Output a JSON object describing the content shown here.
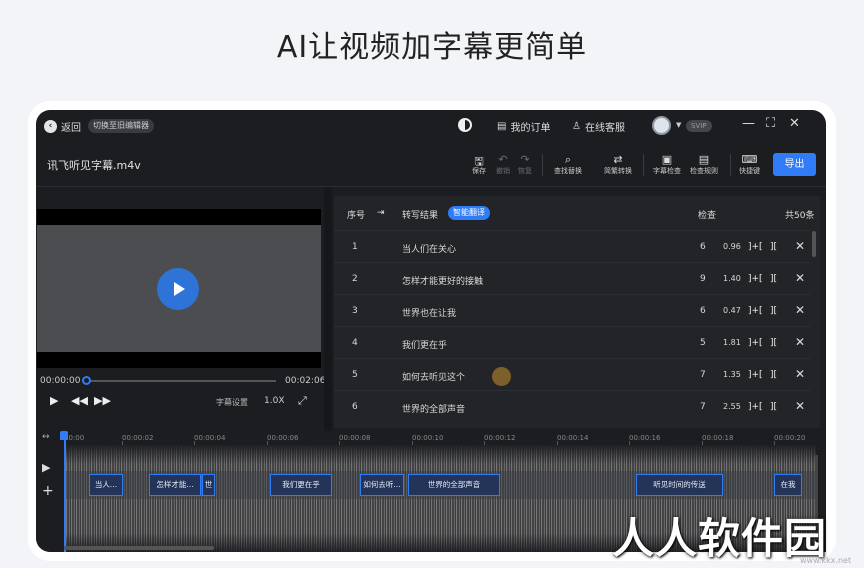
{
  "headline": "AI让视频加字幕更简单",
  "titlebar": {
    "back_label": "返回",
    "switch_label": "切换至旧编辑器",
    "orders_label": "我的订单",
    "service_label": "在线客服",
    "svip_label": "SVIP"
  },
  "file": {
    "name": "讯飞听见字幕.m4v"
  },
  "toolbar": {
    "save": "保存",
    "undo": "撤销",
    "redo": "恢复",
    "find_replace": "查找替换",
    "trad_simp": "简繁转换",
    "subtitle_check": "字幕检查",
    "check_rules": "检查规则",
    "shortcuts": "快捷键",
    "export": "导出"
  },
  "player": {
    "current_time": "00:00:00",
    "total_time": "00:02:06",
    "subtitle_setting": "字幕设置",
    "speed": "1.0X",
    "progress": 0
  },
  "list": {
    "col_no": "序号",
    "col_result": "转写结果",
    "smart_btn": "智能翻译",
    "col_check": "检查",
    "total": "共50条",
    "rows": [
      {
        "no": "1",
        "text": "当人们在关心",
        "chk": "6",
        "dur": "0.96"
      },
      {
        "no": "2",
        "text": "怎样才能更好的接触",
        "chk": "9",
        "dur": "1.40"
      },
      {
        "no": "3",
        "text": "世界也在让我",
        "chk": "6",
        "dur": "0.47"
      },
      {
        "no": "4",
        "text": "我们更在乎",
        "chk": "5",
        "dur": "1.81"
      },
      {
        "no": "5",
        "text": "如何去听见这个",
        "chk": "7",
        "dur": "1.35"
      },
      {
        "no": "6",
        "text": "世界的全部声音",
        "chk": "7",
        "dur": "2.55"
      }
    ],
    "merge_prev": "]+[",
    "split": "][",
    "delete": "✕"
  },
  "timeline": {
    "ticks": [
      "00:00",
      "00:00:02",
      "00:00:04",
      "00:00:06",
      "00:00:08",
      "00:00:10",
      "00:00:12",
      "00:00:14",
      "00:00:16",
      "00:00:18",
      "00:00:20"
    ],
    "segments": [
      "当人...",
      "怎样才能...",
      "世",
      "我们更在乎",
      "如何去听...",
      "世界的全部声音",
      "听见时间的传送",
      "在我"
    ]
  },
  "watermark": {
    "text": "人人软件园",
    "url": "www.kkx.net"
  },
  "colors": {
    "accent": "#2f7cf6",
    "app_bg": "#1c1d21",
    "page_bg": "#f3f4f7"
  }
}
